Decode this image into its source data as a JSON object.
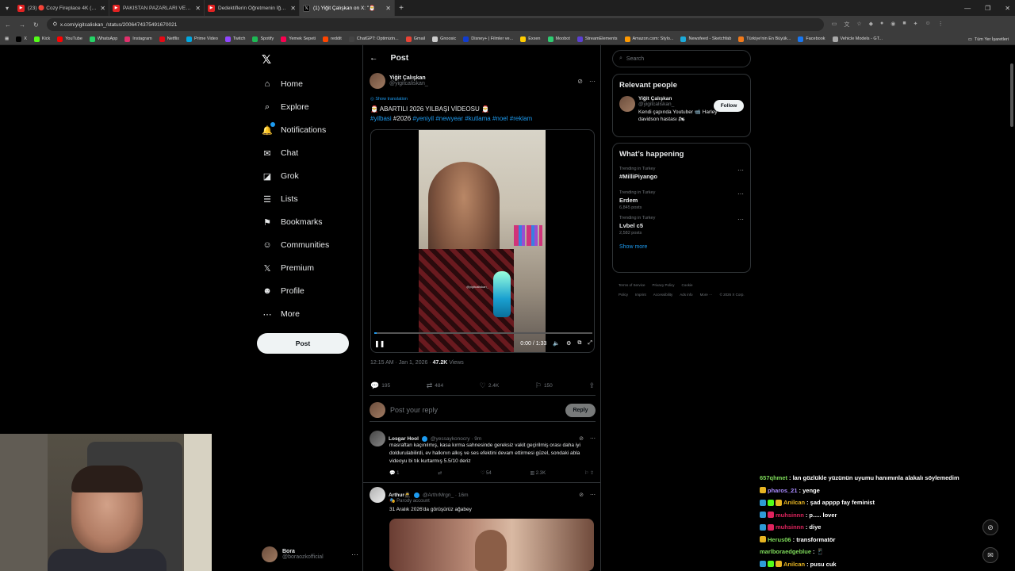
{
  "browser": {
    "tabs": [
      {
        "label": "(23) 🔴 Cozy Fireplace 4K (12 H",
        "icon_color": "#e22222",
        "active": false
      },
      {
        "label": "PAKİSTAN PAZARLARI VE SOKAK",
        "icon_color": "#e22222",
        "active": false
      },
      {
        "label": "Dedektiflerin Öğretmenin İğren",
        "icon_color": "#e22222",
        "active": false
      },
      {
        "label": "(1) Yiğit Çalışkan on X: \"🎅",
        "icon_color": "#000000",
        "active": true
      }
    ],
    "url": "x.com/yigitcaliskan_/status/2006474375491670021",
    "bookmarks": [
      {
        "label": "X",
        "color": "#000000"
      },
      {
        "label": "Kick",
        "color": "#53fc18"
      },
      {
        "label": "YouTube",
        "color": "#ff0000"
      },
      {
        "label": "WhatsApp",
        "color": "#25d366"
      },
      {
        "label": "Instagram",
        "color": "#e1306c"
      },
      {
        "label": "Netflix",
        "color": "#e50914"
      },
      {
        "label": "Prime Video",
        "color": "#00a8e1"
      },
      {
        "label": "Twitch",
        "color": "#9146ff"
      },
      {
        "label": "Spotify",
        "color": "#1db954"
      },
      {
        "label": "Yemek Sepeti",
        "color": "#fa0050"
      },
      {
        "label": "reddit",
        "color": "#ff4500"
      },
      {
        "label": "ChatGPT: Optimizin...",
        "color": "#444444"
      },
      {
        "label": "Gmail",
        "color": "#ea4335"
      },
      {
        "label": "Gnoosic",
        "color": "#cccccc"
      },
      {
        "label": "Disney+ | Filmler ve...",
        "color": "#113ccf"
      },
      {
        "label": "Exxen",
        "color": "#ffcc00"
      },
      {
        "label": "Moobot",
        "color": "#2ecc71"
      },
      {
        "label": "StreamElements",
        "color": "#5b3fd3"
      },
      {
        "label": "Amazon.com: Stylo...",
        "color": "#ff9900"
      },
      {
        "label": "Newsfeed - Sketchfab",
        "color": "#1caad9"
      },
      {
        "label": "Türkiye'nin En Büyük...",
        "color": "#f27a1a"
      },
      {
        "label": "Facebook",
        "color": "#1877f2"
      },
      {
        "label": "Vehicle Models - GT...",
        "color": "#aaaaaa"
      }
    ],
    "bookmarks_right": "Tüm Yer İşaretleri"
  },
  "nav": {
    "items": [
      {
        "label": "Home",
        "icon": "home-icon",
        "glyph": "⌂"
      },
      {
        "label": "Explore",
        "icon": "search-icon",
        "glyph": "⌕"
      },
      {
        "label": "Notifications",
        "icon": "bell-icon",
        "glyph": "🔔"
      },
      {
        "label": "Chat",
        "icon": "mail-icon",
        "glyph": "✉"
      },
      {
        "label": "Grok",
        "icon": "grok-icon",
        "glyph": "◪"
      },
      {
        "label": "Lists",
        "icon": "list-icon",
        "glyph": "☰"
      },
      {
        "label": "Bookmarks",
        "icon": "bookmark-icon",
        "glyph": "⚑"
      },
      {
        "label": "Communities",
        "icon": "people-icon",
        "glyph": "☺"
      },
      {
        "label": "Premium",
        "icon": "x-premium-icon",
        "glyph": "𝕏"
      },
      {
        "label": "Profile",
        "icon": "person-icon",
        "glyph": "☻"
      },
      {
        "label": "More",
        "icon": "more-circle-icon",
        "glyph": "⋯"
      }
    ],
    "post_label": "Post",
    "account": {
      "name": "Bora",
      "handle": "@boraozkofficial"
    }
  },
  "main": {
    "header": "Post",
    "author": {
      "name": "Yiğit Çalışkan",
      "handle": "@yigitcaliskan_"
    },
    "show_translation": "Show translation",
    "text": "🎅 ABARTILI 2026 YILBAŞI VİDEOSU 🎅",
    "hashtags_line": [
      {
        "text": "#yilbasi",
        "tag": true
      },
      {
        "text": "#2026",
        "tag": false
      },
      {
        "text": "#yeniyil",
        "tag": true
      },
      {
        "text": "#newyear",
        "tag": true
      },
      {
        "text": "#kutlama",
        "tag": true
      },
      {
        "text": "#noel",
        "tag": true
      },
      {
        "text": "#reklam",
        "tag": true
      }
    ],
    "video": {
      "watermark": "@yigitcaliskan_",
      "time": "0:00 / 1:33",
      "progress": 0.01
    },
    "meta": {
      "time": "12:15 AM · Jan 1, 2026 ·",
      "views": "47.2K",
      "views_label": "Views"
    },
    "stats": {
      "replies": "195",
      "reposts": "484",
      "likes": "2.4K",
      "bookmarks": "150"
    },
    "reply_placeholder": "Post your reply",
    "reply_button": "Reply",
    "replies": [
      {
        "name": "Losgar Hool",
        "handle": "@yessaykonocry · 9m",
        "text": "masraftan kaçınılmış, kasa kırma sahnesinde gereksiz vakit geçirilmiş orası daha iyi doldurulabilirdi, ev halkının alkış ve ses efektini devam ettirmesi güzel, sondaki abla videoyu bi tık kurtarmış 5.5/10 deriz",
        "stats": {
          "replies": "1",
          "reposts": "",
          "likes": "54",
          "views": "2.3K"
        }
      },
      {
        "name": "Arthur🥷",
        "handle": "@ArthrMrgn_ · 16m",
        "parody": "Parody account",
        "text": "31 Aralık 2026'da görüşürüz ağabey"
      }
    ]
  },
  "right": {
    "search_placeholder": "Search",
    "relevant_title": "Relevant people",
    "relevant": {
      "name": "Yiğit Çalışkan",
      "handle": "@yigitcaliskan_",
      "bio": "Kendi çapında Youtuber 📹 Harley davidson hastası 🏍",
      "follow": "Follow"
    },
    "happening_title": "What’s happening",
    "trends": [
      {
        "context": "Trending in Turkey",
        "name": "#MilliPiyango",
        "posts": ""
      },
      {
        "context": "Trending in Turkey",
        "name": "Erdem",
        "posts": "6,845 posts"
      },
      {
        "context": "Trending in Turkey",
        "name": "Lvbel c5",
        "posts": "2,582 posts"
      }
    ],
    "show_more": "Show more",
    "footer": [
      "Terms of Service",
      "Privacy Policy",
      "Cookie Policy",
      "Imprint",
      "Accessibility",
      "Ads info",
      "More ···",
      "© 2026 X Corp."
    ]
  },
  "stream_chat": [
    {
      "user": "657qhmet",
      "user_color": "#7fdc5b",
      "msg": ": lan gözlükle yüzünün uyumu hanımınla alakalı söylemedim",
      "badges": []
    },
    {
      "user": "pharos_21",
      "user_color": "#a98bff",
      "msg": ": yenge",
      "badges": [
        "#e6b422"
      ]
    },
    {
      "user": "Anilcan",
      "user_color": "#e6b422",
      "msg": ": şad apppp fay feminist",
      "badges": [
        "#2e9bd6",
        "#53fc18",
        "#e6b422"
      ]
    },
    {
      "user": "muhsinnn",
      "user_color": "#e0245e",
      "msg": ": p..... lover",
      "badges": [
        "#2e9bd6",
        "#e0245e"
      ]
    },
    {
      "user": "muhsinnn",
      "user_color": "#e0245e",
      "msg": ": diye",
      "badges": [
        "#2e9bd6",
        "#e0245e"
      ]
    },
    {
      "user": "Herus06",
      "user_color": "#7fdc5b",
      "msg": ": transformatör",
      "badges": [
        "#e6b422"
      ]
    },
    {
      "user": "marlboraedgeblue",
      "user_color": "#7fdc5b",
      "msg": ": 📱",
      "badges": []
    },
    {
      "user": "Anilcan",
      "user_color": "#e6b422",
      "msg": ": pusu cuk",
      "badges": [
        "#2e9bd6",
        "#53fc18",
        "#e6b422"
      ]
    }
  ]
}
